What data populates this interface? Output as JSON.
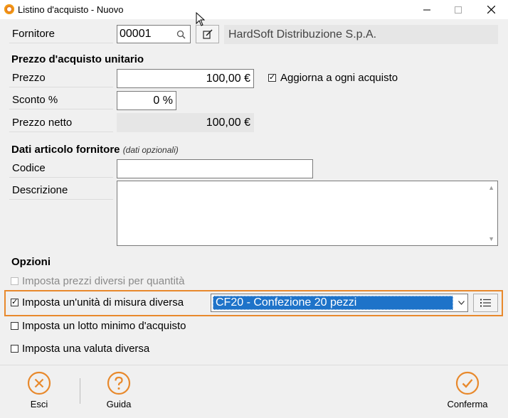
{
  "window": {
    "title": "Listino d'acquisto - Nuovo"
  },
  "supplier": {
    "label": "Fornitore",
    "code": "00001",
    "name": "HardSoft Distribuzione S.p.A."
  },
  "price_section": {
    "title": "Prezzo d'acquisto unitario",
    "price_label": "Prezzo",
    "price_value": "100,00 €",
    "update_checkbox_label": "Aggiorna a ogni acquisto",
    "update_checked": true,
    "discount_label": "Sconto %",
    "discount_value": "0 %",
    "net_label": "Prezzo netto",
    "net_value": "100,00 €"
  },
  "article_section": {
    "title": "Dati articolo fornitore",
    "subtitle": "(dati opzionali)",
    "code_label": "Codice",
    "code_value": "",
    "description_label": "Descrizione",
    "description_value": ""
  },
  "options": {
    "title": "Opzioni",
    "qty_prices": {
      "label": "Imposta prezzi diversi per quantità",
      "checked": false,
      "enabled": false
    },
    "unit": {
      "label": "Imposta un'unità di misura diversa",
      "checked": true,
      "selected": "CF20 - Confezione 20 pezzi"
    },
    "min_lot": {
      "label": "Imposta un lotto minimo d'acquisto",
      "checked": false
    },
    "currency": {
      "label": "Imposta una valuta diversa",
      "checked": false
    }
  },
  "footer": {
    "cancel_label": "Esci",
    "help_label": "Guida",
    "confirm_label": "Conferma"
  },
  "colors": {
    "accent": "#e8892c",
    "selection": "#1e73c9"
  },
  "icons": {
    "check": "✓",
    "minimize": "—",
    "maximize": "☐",
    "close": "✕",
    "dropdown": "⌵"
  }
}
